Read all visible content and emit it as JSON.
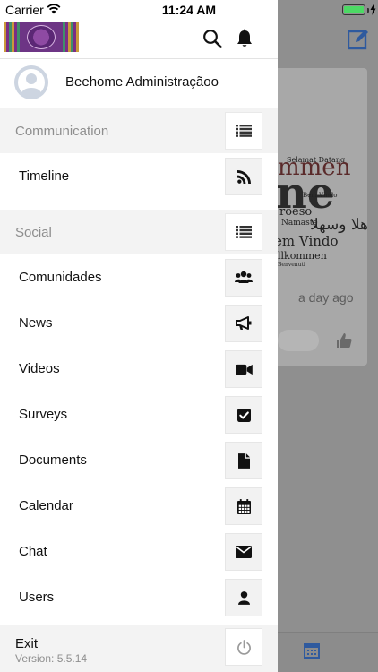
{
  "status_bar": {
    "carrier": "Carrier",
    "time": "11:24 AM"
  },
  "drawer": {
    "header": {
      "logo_icon": "beehome-logo",
      "search_icon": "search-icon",
      "notifications_icon": "bell-icon"
    },
    "profile": {
      "name": "Beehome Administraçãoo",
      "avatar_icon": "user-avatar-icon"
    },
    "sections": [
      {
        "label": "Communication",
        "icon": "list-icon",
        "items": [
          {
            "label": "Timeline",
            "icon": "rss-icon"
          }
        ]
      },
      {
        "label": "Social",
        "icon": "list-icon",
        "items": [
          {
            "label": "Comunidades",
            "icon": "users-icon"
          },
          {
            "label": "News",
            "icon": "megaphone-icon"
          },
          {
            "label": "Videos",
            "icon": "video-camera-icon"
          },
          {
            "label": "Surveys",
            "icon": "checkbox-icon"
          },
          {
            "label": "Documents",
            "icon": "file-icon"
          },
          {
            "label": "Calendar",
            "icon": "calendar-icon"
          },
          {
            "label": "Chat",
            "icon": "envelope-icon"
          },
          {
            "label": "Users",
            "icon": "user-icon"
          }
        ]
      }
    ],
    "footer": {
      "exit_label": "Exit",
      "version": "Version: 5.5.14",
      "icon": "power-icon"
    }
  },
  "background": {
    "post_time": "a day ago",
    "words": [
      "Selamat Datang",
      "mmen",
      "ne",
      "Bem Vindo",
      "roeso",
      "أهلا وسهلا",
      "Namaste",
      "em Vindo",
      "llkommen",
      "Benvenuti"
    ],
    "accent": "#3b82f6"
  },
  "colors": {
    "drawer_bg": "#ffffff",
    "section_bg": "#f3f3f3",
    "section_text": "#8e8e8e",
    "battery": "#4cd964",
    "overlay": "#8f8f8f"
  }
}
